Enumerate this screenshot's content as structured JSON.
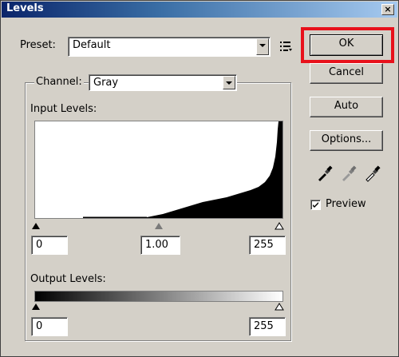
{
  "window": {
    "title": "Levels",
    "close_label": "×"
  },
  "preset": {
    "label": "Preset:",
    "value": "Default",
    "menu_icon": "list-options-icon"
  },
  "channel": {
    "label": "Channel:",
    "value": "Gray"
  },
  "input_levels": {
    "label": "Input Levels:",
    "black": "0",
    "gamma": "1.00",
    "white": "255"
  },
  "output_levels": {
    "label": "Output Levels:",
    "black": "0",
    "white": "255"
  },
  "buttons": {
    "ok": "OK",
    "cancel": "Cancel",
    "auto": "Auto",
    "options": "Options..."
  },
  "preview": {
    "label": "Preview",
    "checked": true
  },
  "eyedroppers": [
    "black-eyedropper-icon",
    "gray-eyedropper-icon",
    "white-eyedropper-icon"
  ],
  "colors": {
    "highlight": "#e8111b",
    "titlebar": "#0a246a",
    "dialog_bg": "#d4d0c8"
  }
}
